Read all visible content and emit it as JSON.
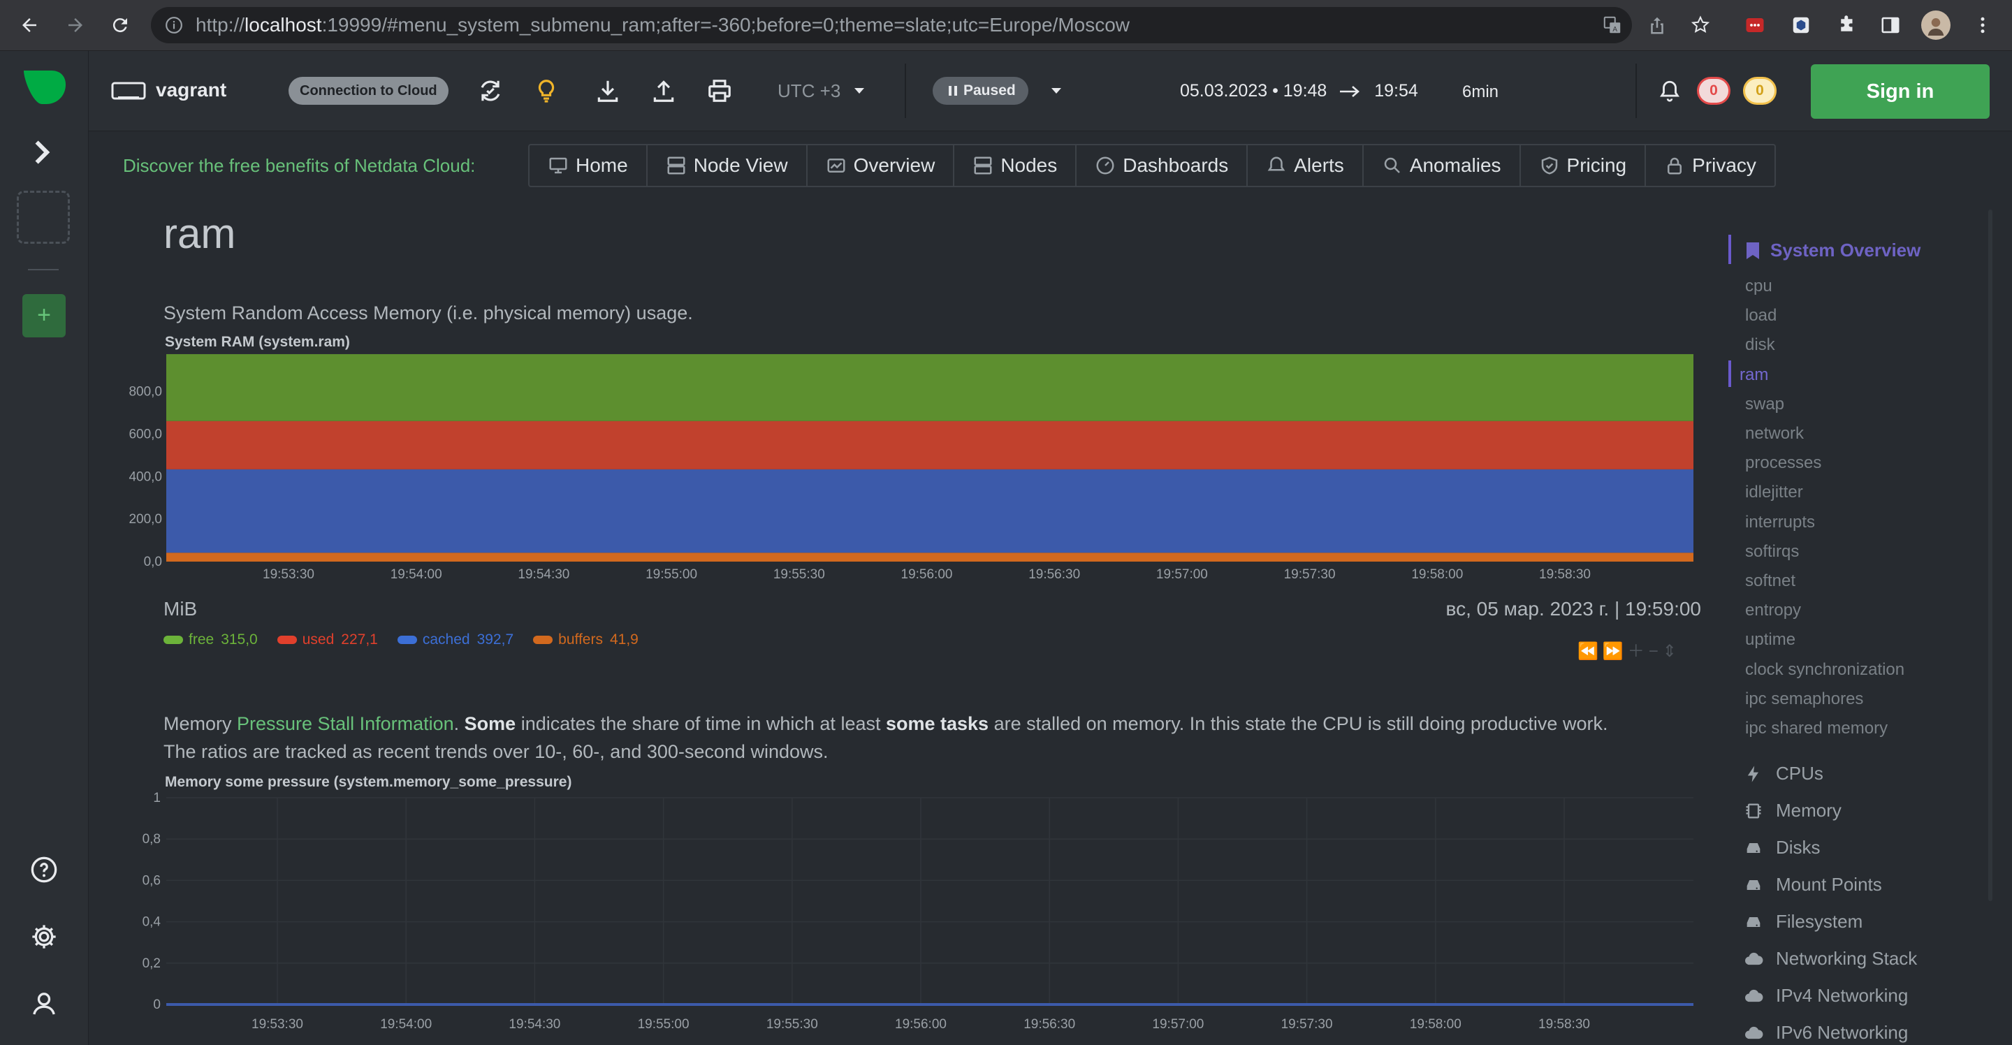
{
  "browser": {
    "url_prefix": "http://",
    "url_host": "localhost",
    "url_rest": ":19999/#menu_system_submenu_ram;after=-360;before=0;theme=slate;utc=Europe/Moscow"
  },
  "header": {
    "node_name": "vagrant",
    "cloud_connection": "Connection to Cloud",
    "timezone": "UTC +3",
    "playback_state": "Paused",
    "date_from": "05.03.2023 • 19:48",
    "date_to": "19:54",
    "duration": "6min",
    "alerts_critical": "0",
    "alerts_warning": "0",
    "sign_in": "Sign in"
  },
  "promo": {
    "label": "Discover the free benefits of Netdata Cloud:",
    "tabs": [
      {
        "label": "Home",
        "icon": "monitor-icon"
      },
      {
        "label": "Node View",
        "icon": "server-icon"
      },
      {
        "label": "Overview",
        "icon": "overview-icon"
      },
      {
        "label": "Nodes",
        "icon": "nodes-icon"
      },
      {
        "label": "Dashboards",
        "icon": "dashboard-icon"
      },
      {
        "label": "Alerts",
        "icon": "bell-icon"
      },
      {
        "label": "Anomalies",
        "icon": "anomalies-icon"
      },
      {
        "label": "Pricing",
        "icon": "shield-check-icon"
      },
      {
        "label": "Privacy",
        "icon": "lock-icon"
      }
    ]
  },
  "main": {
    "title": "ram",
    "ram_description": "System Random Access Memory (i.e. physical memory) usage.",
    "ram_chart_title": "System RAM (system.ram)",
    "ram_unit": "MiB",
    "ram_timestamp": "вс, 05 мар. 2023 г. | 19:59:00",
    "ram_legend": [
      {
        "name": "free",
        "value": "315,0",
        "color": "#6cb33a"
      },
      {
        "name": "used",
        "value": "227,1",
        "color": "#e1402c"
      },
      {
        "name": "cached",
        "value": "392,7",
        "color": "#3c6fd6"
      },
      {
        "name": "buffers",
        "value": "41,9",
        "color": "#d2691e"
      }
    ],
    "pressure_desc": {
      "p1": "Memory ",
      "link": "Pressure Stall Information",
      "p2": ". ",
      "b1": "Some",
      "p3": " indicates the share of time in which at least ",
      "b2": "some tasks",
      "p4": " are stalled on memory. In this state the CPU is still doing productive work.",
      "line2": "The ratios are tracked as recent trends over 10-, 60-, and 300-second windows."
    },
    "pressure_chart_title": "Memory some pressure (system.memory_some_pressure)"
  },
  "chart_data": [
    {
      "type": "area",
      "title": "System RAM (system.ram)",
      "ylabel": "MiB",
      "stacked": true,
      "x": [
        "19:53:30",
        "19:54:00",
        "19:54:30",
        "19:55:00",
        "19:55:30",
        "19:56:00",
        "19:56:30",
        "19:57:00",
        "19:57:30",
        "19:58:00",
        "19:58:30"
      ],
      "y_ticks": [
        "0,0",
        "200,0",
        "400,0",
        "600,0",
        "800,0"
      ],
      "ylim": [
        0,
        980
      ],
      "series": [
        {
          "name": "buffers",
          "values": [
            41.9,
            41.9,
            41.9,
            41.9,
            41.9,
            41.9,
            41.9,
            41.9,
            41.9,
            41.9,
            41.9
          ],
          "color": "#d2691e"
        },
        {
          "name": "cached",
          "values": [
            392.7,
            392.7,
            392.7,
            392.7,
            392.7,
            392.7,
            392.7,
            392.7,
            392.7,
            392.7,
            392.7
          ],
          "color": "#3c5aaa"
        },
        {
          "name": "used",
          "values": [
            227.1,
            227.1,
            227.1,
            227.1,
            227.1,
            227.1,
            227.1,
            227.1,
            227.1,
            227.1,
            227.1
          ],
          "color": "#c1412d"
        },
        {
          "name": "free",
          "values": [
            315.0,
            315.0,
            315.0,
            315.0,
            315.0,
            315.0,
            315.0,
            315.0,
            315.0,
            315.0,
            315.0
          ],
          "color": "#5d8f2f"
        }
      ]
    },
    {
      "type": "line",
      "title": "Memory some pressure (system.memory_some_pressure)",
      "x": [
        "19:53:30",
        "19:54:00",
        "19:54:30",
        "19:55:00",
        "19:55:30",
        "19:56:00",
        "19:56:30",
        "19:57:00",
        "19:57:30",
        "19:58:00",
        "19:58:30"
      ],
      "y_ticks": [
        "0",
        "0,2",
        "0,4",
        "0,6",
        "0,8",
        "1"
      ],
      "ylim": [
        0,
        1
      ],
      "series": [
        {
          "values": [
            0,
            0,
            0,
            0,
            0,
            0,
            0,
            0,
            0,
            0,
            0
          ],
          "color": "#3c5aaa"
        }
      ]
    }
  ],
  "right_menu": {
    "overview": "System Overview",
    "submenu": [
      "cpu",
      "load",
      "disk",
      "ram",
      "swap",
      "network",
      "processes",
      "idlejitter",
      "interrupts",
      "softirqs",
      "softnet",
      "entropy",
      "uptime",
      "clock synchronization",
      "ipc semaphores",
      "ipc shared memory"
    ],
    "active_submenu": "ram",
    "sections": [
      {
        "label": "CPUs",
        "icon": "bolt-icon"
      },
      {
        "label": "Memory",
        "icon": "chip-icon"
      },
      {
        "label": "Disks",
        "icon": "hdd-icon"
      },
      {
        "label": "Mount Points",
        "icon": "hdd-icon"
      },
      {
        "label": "Filesystem",
        "icon": "hdd-icon"
      },
      {
        "label": "Networking Stack",
        "icon": "cloud-icon"
      },
      {
        "label": "IPv4 Networking",
        "icon": "cloud-icon"
      },
      {
        "label": "IPv6 Networking",
        "icon": "cloud-icon"
      }
    ]
  },
  "colors": {
    "accent_green": "#68c17a",
    "menu_active": "#7468d0",
    "background": "#272b30"
  }
}
